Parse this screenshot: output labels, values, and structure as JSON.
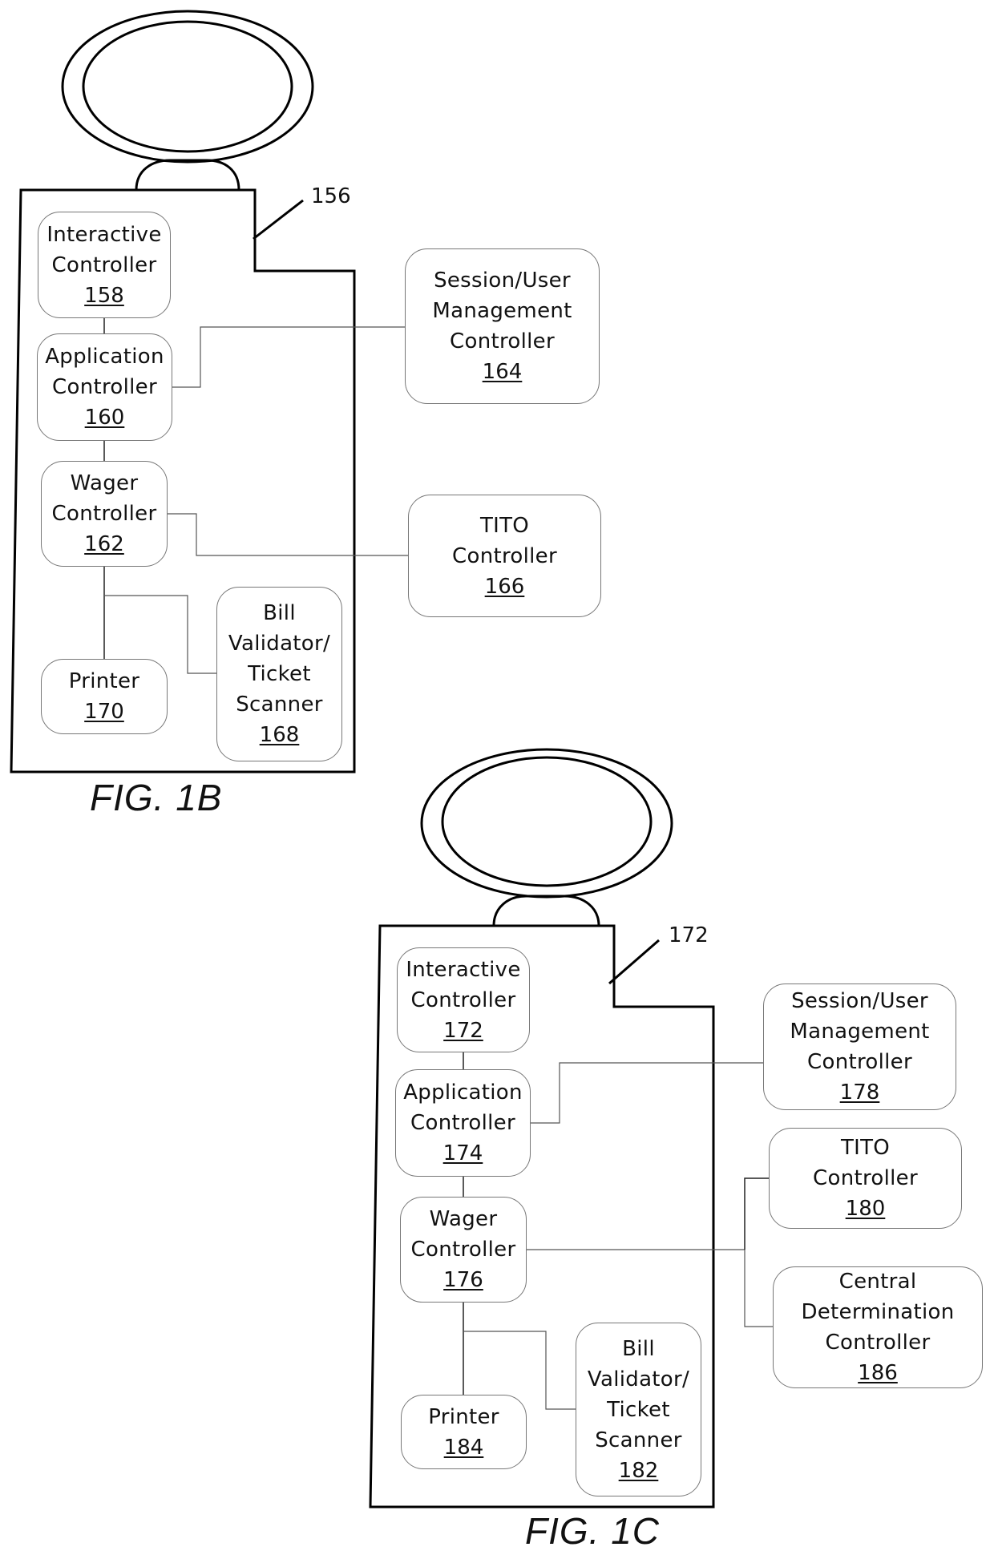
{
  "figures": [
    {
      "id": "fig1b",
      "caption": "FIG. 1B",
      "reference": "156",
      "nodes": {
        "interactive": {
          "lines": [
            "Interactive",
            "Controller"
          ],
          "ref": "158"
        },
        "application": {
          "lines": [
            "Application",
            "Controller"
          ],
          "ref": "160"
        },
        "wager": {
          "lines": [
            "Wager",
            "Controller"
          ],
          "ref": "162"
        },
        "printer": {
          "lines": [
            "Printer"
          ],
          "ref": "170"
        },
        "bill": {
          "lines": [
            "Bill",
            "Validator/",
            "Ticket",
            "Scanner"
          ],
          "ref": "168"
        },
        "session": {
          "lines": [
            "Session/User",
            "Management",
            "Controller"
          ],
          "ref": "164"
        },
        "tito": {
          "lines": [
            "TITO",
            "Controller"
          ],
          "ref": "166"
        }
      }
    },
    {
      "id": "fig1c",
      "caption": "FIG. 1C",
      "reference": "172",
      "nodes": {
        "interactive": {
          "lines": [
            "Interactive",
            "Controller"
          ],
          "ref": "172"
        },
        "application": {
          "lines": [
            "Application",
            "Controller"
          ],
          "ref": "174"
        },
        "wager": {
          "lines": [
            "Wager",
            "Controller"
          ],
          "ref": "176"
        },
        "printer": {
          "lines": [
            "Printer"
          ],
          "ref": "184"
        },
        "bill": {
          "lines": [
            "Bill",
            "Validator/",
            "Ticket",
            "Scanner"
          ],
          "ref": "182"
        },
        "session": {
          "lines": [
            "Session/User",
            "Management",
            "Controller"
          ],
          "ref": "178"
        },
        "tito": {
          "lines": [
            "TITO",
            "Controller"
          ],
          "ref": "180"
        },
        "central": {
          "lines": [
            "Central",
            "Determination",
            "Controller"
          ],
          "ref": "186"
        }
      }
    }
  ]
}
